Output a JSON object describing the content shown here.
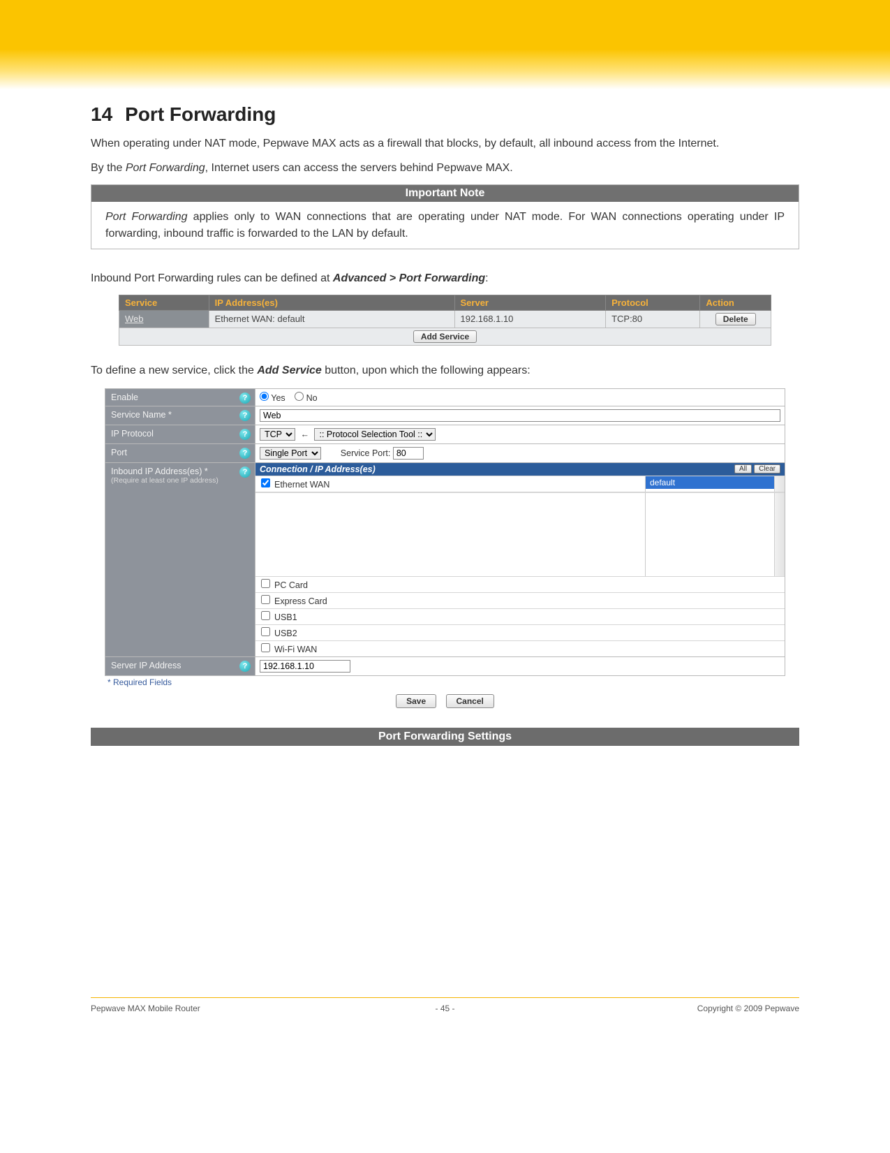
{
  "heading": {
    "num": "14",
    "title": "Port Forwarding"
  },
  "para1": "When operating under NAT mode, Pepwave MAX acts as a firewall that blocks, by default, all inbound access from the Internet.",
  "para2_a": "By the ",
  "para2_em": "Port Forwarding",
  "para2_b": ", Internet users can access the servers behind Pepwave MAX.",
  "note": {
    "header": "Important Note",
    "body_em": "Port Forwarding",
    "body_rest": " applies only to WAN connections that are operating under NAT mode. For WAN connections operating under IP forwarding, inbound traffic is forwarded to the LAN by default."
  },
  "para3_a": "Inbound Port Forwarding rules can be defined at ",
  "para3_b": "Advanced > Port Forwarding",
  "para3_c": ":",
  "rules": {
    "headers": {
      "service": "Service",
      "ip": "IP Address(es)",
      "server": "Server",
      "protocol": "Protocol",
      "action": "Action"
    },
    "row": {
      "service": "Web",
      "ip": "Ethernet WAN: default",
      "server": "192.168.1.10",
      "protocol": "TCP:80",
      "delete": "Delete"
    },
    "add": "Add Service"
  },
  "para4_a": "To define a new service, click the ",
  "para4_b": "Add Service",
  "para4_c": " button, upon which the following appears:",
  "form": {
    "enable": {
      "label": "Enable",
      "yes": "Yes",
      "no": "No"
    },
    "service_name": {
      "label": "Service Name *",
      "value": "Web"
    },
    "ip_proto": {
      "label": "IP Protocol",
      "proto_select": "TCP",
      "tool_select": ":: Protocol Selection Tool ::"
    },
    "port": {
      "label": "Port",
      "type_select": "Single Port",
      "sp_label": "Service Port:",
      "sp_value": "80"
    },
    "inbound": {
      "label": "Inbound IP Address(es) *",
      "sub": "(Require at least one IP address)",
      "panel_header": "Connection / IP Address(es)",
      "btn_all": "All",
      "btn_clear": "Clear",
      "main_conn": "Ethernet WAN",
      "selected": "default",
      "others": [
        "PC Card",
        "Express Card",
        "USB1",
        "USB2",
        "Wi-Fi WAN"
      ]
    },
    "server_ip": {
      "label": "Server IP Address",
      "value": "192.168.1.10"
    },
    "required": "* Required Fields",
    "save": "Save",
    "cancel": "Cancel"
  },
  "settings_header": "Port Forwarding Settings",
  "footer": {
    "left": "Pepwave MAX Mobile Router",
    "mid": "- 45 -",
    "right": "Copyright © 2009 Pepwave"
  }
}
